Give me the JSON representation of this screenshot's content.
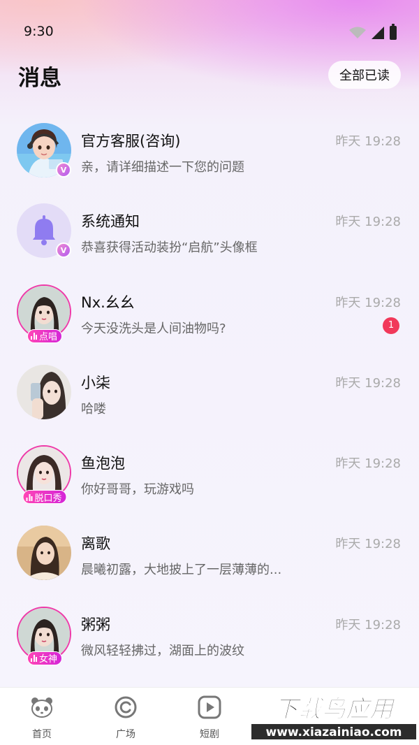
{
  "status_bar": {
    "time": "9:30"
  },
  "header": {
    "title": "消息",
    "read_all_label": "全部已读"
  },
  "conversations": [
    {
      "name": "官方客服(咨询)",
      "preview": "亲，请详细描述一下您的问题",
      "time": "昨天 19:28",
      "verified": "V"
    },
    {
      "name": "系统通知",
      "preview": "恭喜获得活动装扮“启航”头像框",
      "time": "昨天 19:28",
      "verified": "V"
    },
    {
      "name": "Nx.幺幺",
      "preview": "今天没洗头是人间油物吗?",
      "time": "昨天 19:28",
      "tag": "点唱",
      "unread": "1"
    },
    {
      "name": "小柒",
      "preview": "哈喽",
      "time": "昨天 19:28"
    },
    {
      "name": "鱼泡泡",
      "preview": "你好哥哥，玩游戏吗",
      "time": "昨天 19:28",
      "tag": "脱口秀"
    },
    {
      "name": "离歌",
      "preview": "晨曦初露，大地披上了一层薄薄的...",
      "time": "昨天 19:28"
    },
    {
      "name": "粥粥",
      "preview": "微风轻轻拂过，湖面上的波纹",
      "time": "昨天 19:28",
      "tag": "女神"
    }
  ],
  "tabbar": {
    "tabs": [
      {
        "label": "首页",
        "icon": "panda-icon"
      },
      {
        "label": "广场",
        "icon": "plaza-icon"
      },
      {
        "label": "短剧",
        "icon": "play-icon"
      }
    ]
  },
  "watermark": {
    "text": "下载鸟应用",
    "url": "www.xiazainiao.com"
  },
  "colors": {
    "accent": "#ee3aa8",
    "unread": "#f1395a",
    "tag_gradient_start": "#ff46b5",
    "tag_gradient_end": "#d425d8"
  }
}
